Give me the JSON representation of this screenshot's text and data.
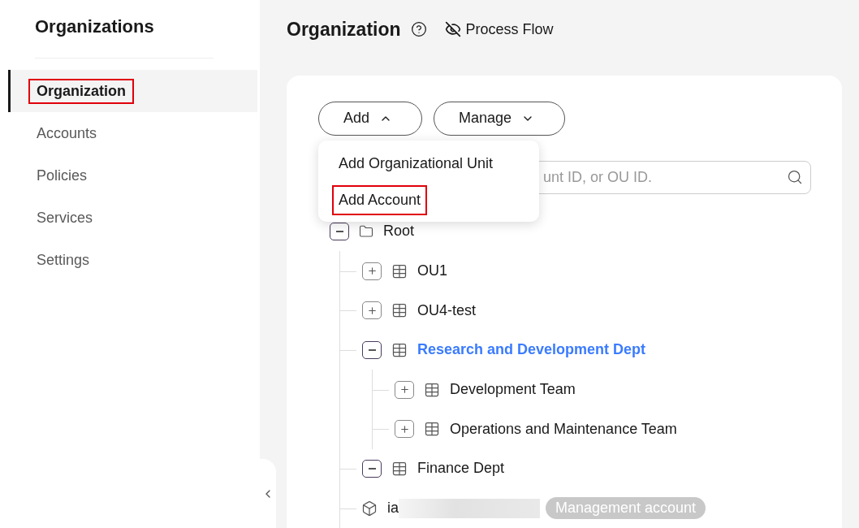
{
  "sidebar": {
    "title": "Organizations",
    "items": [
      {
        "label": "Organization",
        "selected": true,
        "highlighted": true
      },
      {
        "label": "Accounts",
        "selected": false,
        "highlighted": false
      },
      {
        "label": "Policies",
        "selected": false,
        "highlighted": false
      },
      {
        "label": "Services",
        "selected": false,
        "highlighted": false
      },
      {
        "label": "Settings",
        "selected": false,
        "highlighted": false
      }
    ]
  },
  "header": {
    "title": "Organization",
    "process_flow": "Process Flow"
  },
  "toolbar": {
    "add": {
      "label": "Add",
      "expanded": true
    },
    "manage": {
      "label": "Manage",
      "expanded": false
    }
  },
  "add_menu": [
    {
      "label": "Add Organizational Unit",
      "highlighted": false
    },
    {
      "label": "Add Account",
      "highlighted": true
    }
  ],
  "search": {
    "placeholder": "unt ID, or OU ID."
  },
  "tree": [
    {
      "kind": "root",
      "label": "Root",
      "expanded": true,
      "selected": false,
      "children": [
        {
          "kind": "ou",
          "label": "OU1",
          "expanded": false,
          "selected": false
        },
        {
          "kind": "ou",
          "label": "OU4-test",
          "expanded": false,
          "selected": false
        },
        {
          "kind": "ou",
          "label": "Research and Development Dept",
          "expanded": true,
          "selected": true,
          "children": [
            {
              "kind": "ou",
              "label": "Development Team",
              "expanded": false,
              "selected": false
            },
            {
              "kind": "ou",
              "label": "Operations and Maintenance Team",
              "expanded": false,
              "selected": false
            }
          ]
        },
        {
          "kind": "ou",
          "label": "Finance Dept",
          "expanded": true,
          "selected": false
        },
        {
          "kind": "account",
          "label": "ia",
          "redacted": true,
          "badge": "Management account",
          "selected": false
        }
      ]
    }
  ]
}
